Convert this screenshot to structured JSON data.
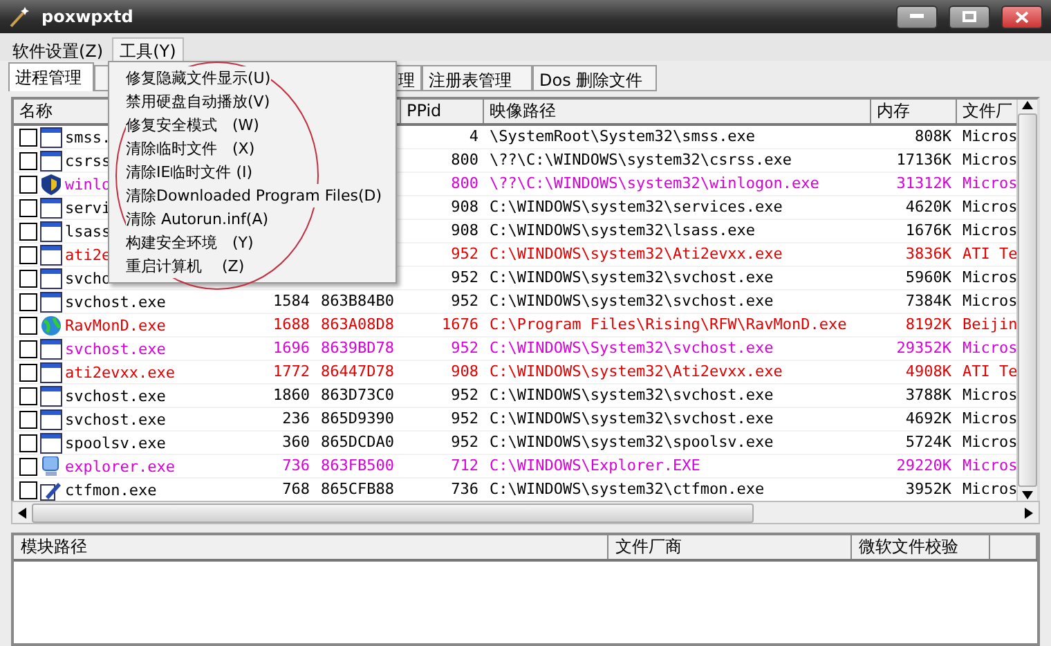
{
  "window": {
    "title": "poxwpxtd"
  },
  "menubar": [
    {
      "label": "软件设置(Z)",
      "selected": false
    },
    {
      "label": "工具(Y)",
      "selected": true
    }
  ],
  "tabs": [
    {
      "label": "进程管理",
      "selected": true
    },
    {
      "label": "理",
      "selected": false
    },
    {
      "label": "注册表管理",
      "selected": false
    },
    {
      "label": "Dos 删除文件",
      "selected": false
    }
  ],
  "table": {
    "columns": [
      "名称",
      "",
      "",
      "PPid",
      "映像路径",
      "内存",
      "文件厂"
    ],
    "rows": [
      {
        "kind": "window",
        "color": "#000000",
        "checked": false,
        "cells": [
          "smss.",
          "",
          "",
          "4",
          "\\SystemRoot\\System32\\smss.exe",
          "808K",
          "Micros"
        ]
      },
      {
        "kind": "window",
        "color": "#000000",
        "checked": false,
        "cells": [
          "csrss",
          "",
          "",
          "800",
          "\\??\\C:\\WINDOWS\\system32\\csrss.exe",
          "17136K",
          "Micros"
        ]
      },
      {
        "kind": "shield",
        "color": "#d800d8",
        "checked": false,
        "cells": [
          "winlo",
          "",
          "",
          "800",
          "\\??\\C:\\WINDOWS\\system32\\winlogon.exe",
          "31312K",
          "Micros"
        ]
      },
      {
        "kind": "window",
        "color": "#000000",
        "checked": false,
        "cells": [
          "servi",
          "",
          "",
          "908",
          "C:\\WINDOWS\\system32\\services.exe",
          "4620K",
          "Micros"
        ]
      },
      {
        "kind": "window",
        "color": "#000000",
        "checked": false,
        "cells": [
          "lsass",
          "",
          "",
          "908",
          "C:\\WINDOWS\\system32\\lsass.exe",
          "1676K",
          "Micros"
        ]
      },
      {
        "kind": "window",
        "color": "#e00000",
        "checked": false,
        "cells": [
          "ati2e",
          "",
          "",
          "952",
          "C:\\WINDOWS\\system32\\Ati2evxx.exe",
          "3836K",
          "ATI Te"
        ]
      },
      {
        "kind": "window",
        "color": "#000000",
        "checked": false,
        "cells": [
          "svcho",
          "",
          "",
          "952",
          "C:\\WINDOWS\\system32\\svchost.exe",
          "5960K",
          "Micros"
        ]
      },
      {
        "kind": "window",
        "color": "#000000",
        "checked": false,
        "cells": [
          "svchost.exe",
          "1584",
          "863B84B0",
          "952",
          "C:\\WINDOWS\\system32\\svchost.exe",
          "7384K",
          "Micros"
        ]
      },
      {
        "kind": "globe",
        "color": "#e00000",
        "checked": false,
        "cells": [
          "RavMonD.exe",
          "1688",
          "863A08D8",
          "1676",
          "C:\\Program Files\\Rising\\RFW\\RavMonD.exe",
          "8192K",
          "Beijin"
        ]
      },
      {
        "kind": "window",
        "color": "#d800d8",
        "checked": false,
        "cells": [
          "svchost.exe",
          "1696",
          "8639BD78",
          "952",
          "C:\\WINDOWS\\System32\\svchost.exe",
          "29352K",
          "Micros"
        ]
      },
      {
        "kind": "window",
        "color": "#e00000",
        "checked": false,
        "cells": [
          "ati2evxx.exe",
          "1772",
          "86447D78",
          "908",
          "C:\\WINDOWS\\system32\\Ati2evxx.exe",
          "4908K",
          "ATI Te"
        ]
      },
      {
        "kind": "window",
        "color": "#000000",
        "checked": false,
        "cells": [
          "svchost.exe",
          "1860",
          "863D73C0",
          "952",
          "C:\\WINDOWS\\system32\\svchost.exe",
          "3788K",
          "Micros"
        ]
      },
      {
        "kind": "window",
        "color": "#000000",
        "checked": false,
        "cells": [
          "svchost.exe",
          "236",
          "865D9390",
          "952",
          "C:\\WINDOWS\\system32\\svchost.exe",
          "4692K",
          "Micros"
        ]
      },
      {
        "kind": "window",
        "color": "#000000",
        "checked": false,
        "cells": [
          "spoolsv.exe",
          "360",
          "865DCDA0",
          "952",
          "C:\\WINDOWS\\system32\\spoolsv.exe",
          "5724K",
          "Micros"
        ]
      },
      {
        "kind": "computer",
        "color": "#d800d8",
        "checked": false,
        "cells": [
          "explorer.exe",
          "736",
          "863FB500",
          "712",
          "C:\\WINDOWS\\Explorer.EXE",
          "29220K",
          "Micros"
        ]
      },
      {
        "kind": "pen",
        "color": "#000000",
        "checked": false,
        "cells": [
          "ctfmon.exe",
          "768",
          "865CFB88",
          "736",
          "C:\\WINDOWS\\system32\\ctfmon.exe",
          "3952K",
          "Micros"
        ]
      }
    ]
  },
  "module_table": {
    "columns": [
      "模块路径",
      "文件厂商",
      "微软文件校验"
    ]
  },
  "dropdown_menu": [
    "修复隐藏文件显示(U)",
    "禁用硬盘自动播放(V)",
    "修复安全模式　(W)",
    "清除临时文件　(X)",
    "清除IE临时文件 (I)",
    "清除Downloaded Program Files(D)",
    "清除 Autorun.inf(A)",
    "构建安全环境　(Y)",
    "重启计算机　 (Z)"
  ]
}
